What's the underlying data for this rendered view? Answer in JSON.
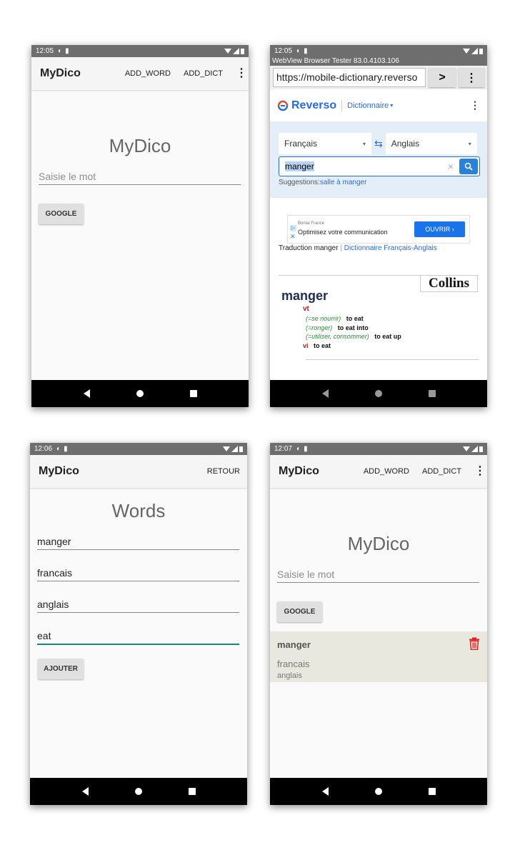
{
  "colors": {
    "accent": "#168a7e",
    "reverso_blue": "#2a6cd6",
    "delete_red": "#e02020",
    "status_bar": "#6e6e6e"
  },
  "phone1": {
    "status_time": "12:05",
    "app_title": "MyDico",
    "actions": {
      "add_word": "ADD_WORD",
      "add_dict": "ADD_DICT"
    },
    "heading": "MyDico",
    "input_placeholder": "Saisie le mot",
    "google_button": "GOOGLE"
  },
  "phone2": {
    "status_time": "12:05",
    "webview_title": "WebView Browser Tester 83.0.4103.106",
    "url": "https://mobile-dictionary.reverso",
    "go_button": ">",
    "reverso": {
      "logo": "Reverso",
      "section": "Dictionnaire"
    },
    "source_lang": "Français",
    "target_lang": "Anglais",
    "search_value": "manger",
    "suggestions_label": "Suggestions:",
    "suggestion": "salle à manger",
    "ad": {
      "brand": "Bonial France",
      "text": "Optimisez votre communication",
      "cta": "OUVRIR"
    },
    "translation_label": "Traduction manger",
    "translation_link": "Dictionnaire Français-Anglais",
    "collins": "Collins",
    "entry": {
      "headword": "manger",
      "pos1": "vt",
      "senses": [
        {
          "gloss": "(=se nourrir)",
          "translation": "to eat"
        },
        {
          "gloss": "(=ronger)",
          "translation": "to eat into"
        },
        {
          "gloss": "(=utiliser, consommer)",
          "translation": "to eat up"
        }
      ],
      "pos2": "vi",
      "vi_translation": "to eat"
    }
  },
  "phone3": {
    "status_time": "12:06",
    "app_title": "MyDico",
    "back_action": "RETOUR",
    "heading": "Words",
    "fields": [
      "manger",
      "francais",
      "anglais",
      "eat"
    ],
    "add_button": "AJOUTER"
  },
  "phone4": {
    "status_time": "12:07",
    "app_title": "MyDico",
    "actions": {
      "add_word": "ADD_WORD",
      "add_dict": "ADD_DICT"
    },
    "heading": "MyDico",
    "input_placeholder": "Saisie le mot",
    "google_button": "GOOGLE",
    "word_item": {
      "word": "manger",
      "lang_from": "francais",
      "lang_to": "anglais"
    }
  }
}
